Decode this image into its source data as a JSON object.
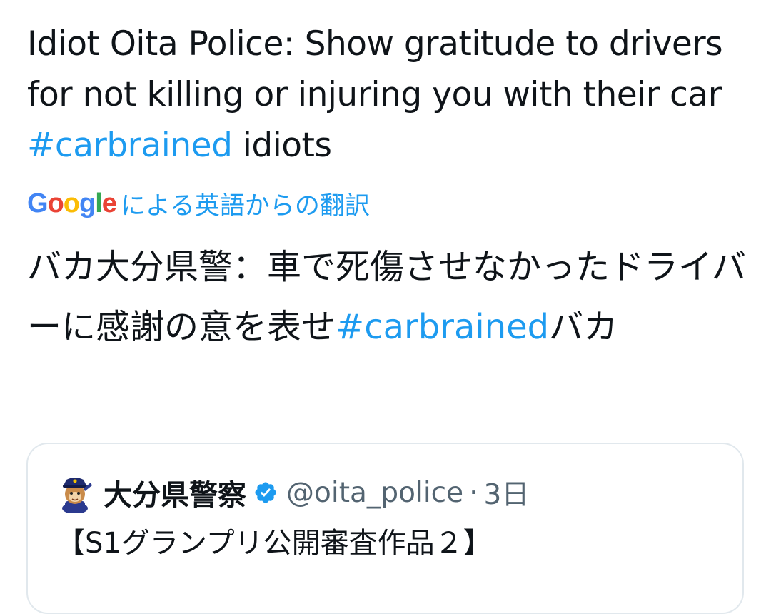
{
  "tweet": {
    "text_part1": "Idiot Oita Police: Show gratitude to drivers for not killing or injuring you with their car ",
    "hashtag": "#carbrained",
    "text_part2": " idiots"
  },
  "translation": {
    "google_letters": [
      "G",
      "o",
      "o",
      "g",
      "l",
      "e"
    ],
    "google_colors": [
      "#4285f4",
      "#ea4335",
      "#fbbc05",
      "#4285f4",
      "#34a853",
      "#ea4335"
    ],
    "label": "による英語からの翻訳",
    "text_part1": "バカ大分県警：車で死傷させなかったドライバーに感謝の意を表せ",
    "hashtag": "#carbrained",
    "text_part2": "バカ"
  },
  "quoted_tweet": {
    "display_name": "大分県警察",
    "handle": "@oita_police",
    "separator": "·",
    "time": "3日",
    "text": "【S1グランプリ公開審査作品２】",
    "verified_color": "#1d9bf0"
  }
}
